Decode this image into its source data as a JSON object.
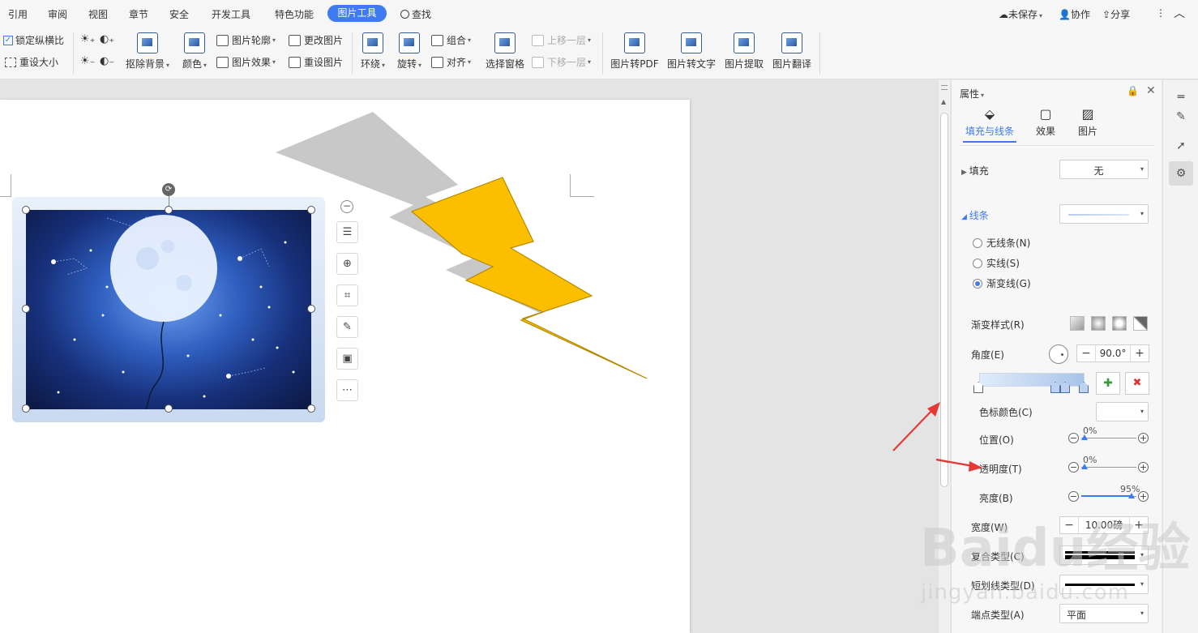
{
  "menubar": {
    "tabs": [
      "引用",
      "审阅",
      "视图",
      "章节",
      "安全",
      "开发工具",
      "特色功能"
    ],
    "active_tab": "图片工具",
    "search": "查找",
    "right": {
      "unsaved": "未保存",
      "collab": "协作",
      "share": "分享"
    }
  },
  "ribbon": {
    "lock_ratio": "锁定纵横比",
    "reset_size": "重设大小",
    "remove_bg": "抠除背景",
    "color": "颜色",
    "outline": "图片轮廓",
    "effect": "图片效果",
    "change_pic": "更改图片",
    "reset_pic": "重设图片",
    "wrap": "环绕",
    "rotate": "旋转",
    "group": "组合",
    "align": "对齐",
    "select_pane": "选择窗格",
    "bring_forward": "上移一层",
    "send_backward": "下移一层",
    "to_pdf": "图片转PDF",
    "to_text": "图片转文字",
    "extract": "图片提取",
    "translate": "图片翻译"
  },
  "panel": {
    "title": "属性",
    "tabs": [
      "填充与线条",
      "效果",
      "图片"
    ],
    "fill_label": "填充",
    "fill_value": "无",
    "line_label": "线条",
    "radios": [
      "无线条(N)",
      "实线(S)",
      "渐变线(G)"
    ],
    "gradient_style": "渐变样式(R)",
    "angle_label": "角度(E)",
    "angle_value": "90.0°",
    "stop_color": "色标颜色(C)",
    "position_label": "位置(O)",
    "position_value": "0%",
    "transparency_label": "透明度(T)",
    "transparency_value": "0%",
    "brightness_label": "亮度(B)",
    "brightness_value": "95%",
    "width_label": "宽度(W)",
    "width_value": "10.00磅",
    "compound_label": "复合类型(C)",
    "dash_label": "短划线类型(D)",
    "cap_label": "端点类型(A)",
    "cap_value": "平面"
  },
  "watermark": {
    "brand": "Baidu经验",
    "url": "jingyan.baidu.com"
  },
  "colors": {
    "accent": "#3e7bf0",
    "bolt": "#fcbf00",
    "bolt_stroke": "#b58a00"
  }
}
